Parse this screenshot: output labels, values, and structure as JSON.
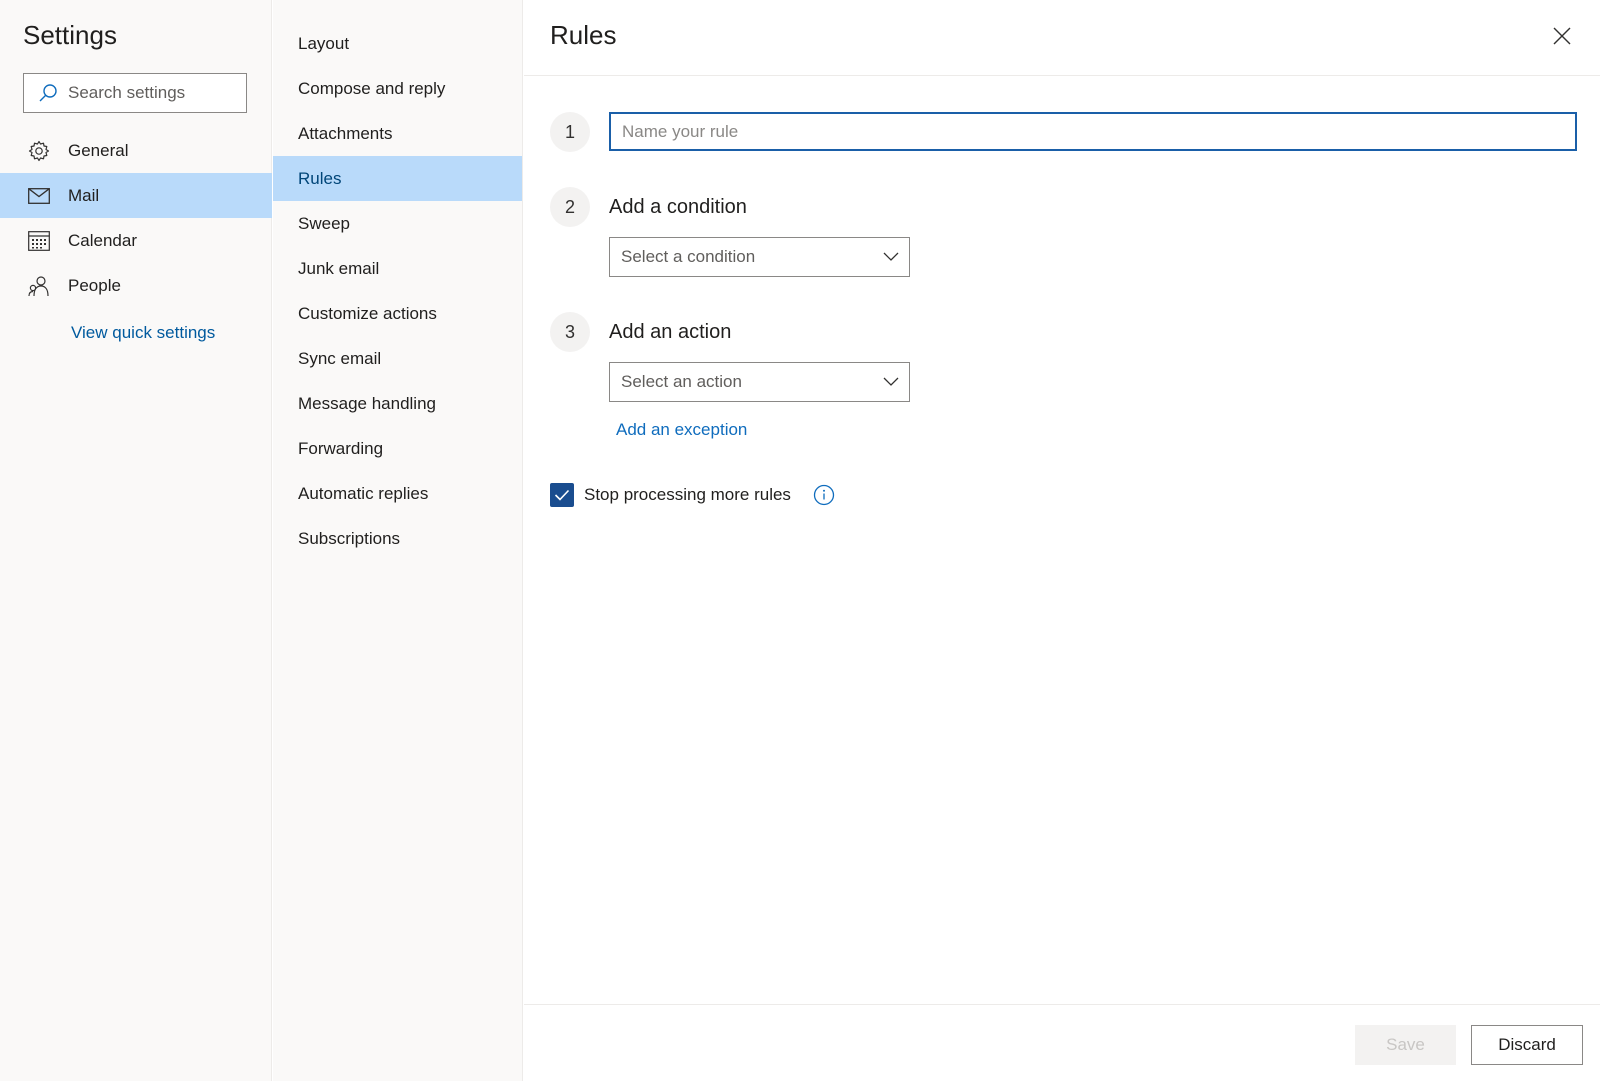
{
  "settings": {
    "title": "Settings",
    "search_placeholder": "Search settings",
    "nav": [
      {
        "label": "General",
        "icon": "gear-icon"
      },
      {
        "label": "Mail",
        "icon": "mail-icon",
        "selected": true
      },
      {
        "label": "Calendar",
        "icon": "calendar-icon"
      },
      {
        "label": "People",
        "icon": "people-icon"
      }
    ],
    "quick_settings_link": "View quick settings"
  },
  "mail_menu": {
    "items": [
      "Layout",
      "Compose and reply",
      "Attachments",
      "Rules",
      "Sweep",
      "Junk email",
      "Customize actions",
      "Sync email",
      "Message handling",
      "Forwarding",
      "Automatic replies",
      "Subscriptions"
    ],
    "selected": "Rules"
  },
  "rules": {
    "title": "Rules",
    "step1": {
      "number": "1",
      "name_placeholder": "Name your rule",
      "name_value": ""
    },
    "step2": {
      "number": "2",
      "title": "Add a condition",
      "dropdown_placeholder": "Select a condition"
    },
    "step3": {
      "number": "3",
      "title": "Add an action",
      "dropdown_placeholder": "Select an action"
    },
    "exception_link": "Add an exception",
    "stop_processing": {
      "label": "Stop processing more rules",
      "checked": true
    }
  },
  "footer": {
    "save_label": "Save",
    "discard_label": "Discard"
  },
  "colors": {
    "accent": "#0f6cbd",
    "selected_bg": "#b9dafa",
    "checkbox": "#1a4d8f"
  }
}
